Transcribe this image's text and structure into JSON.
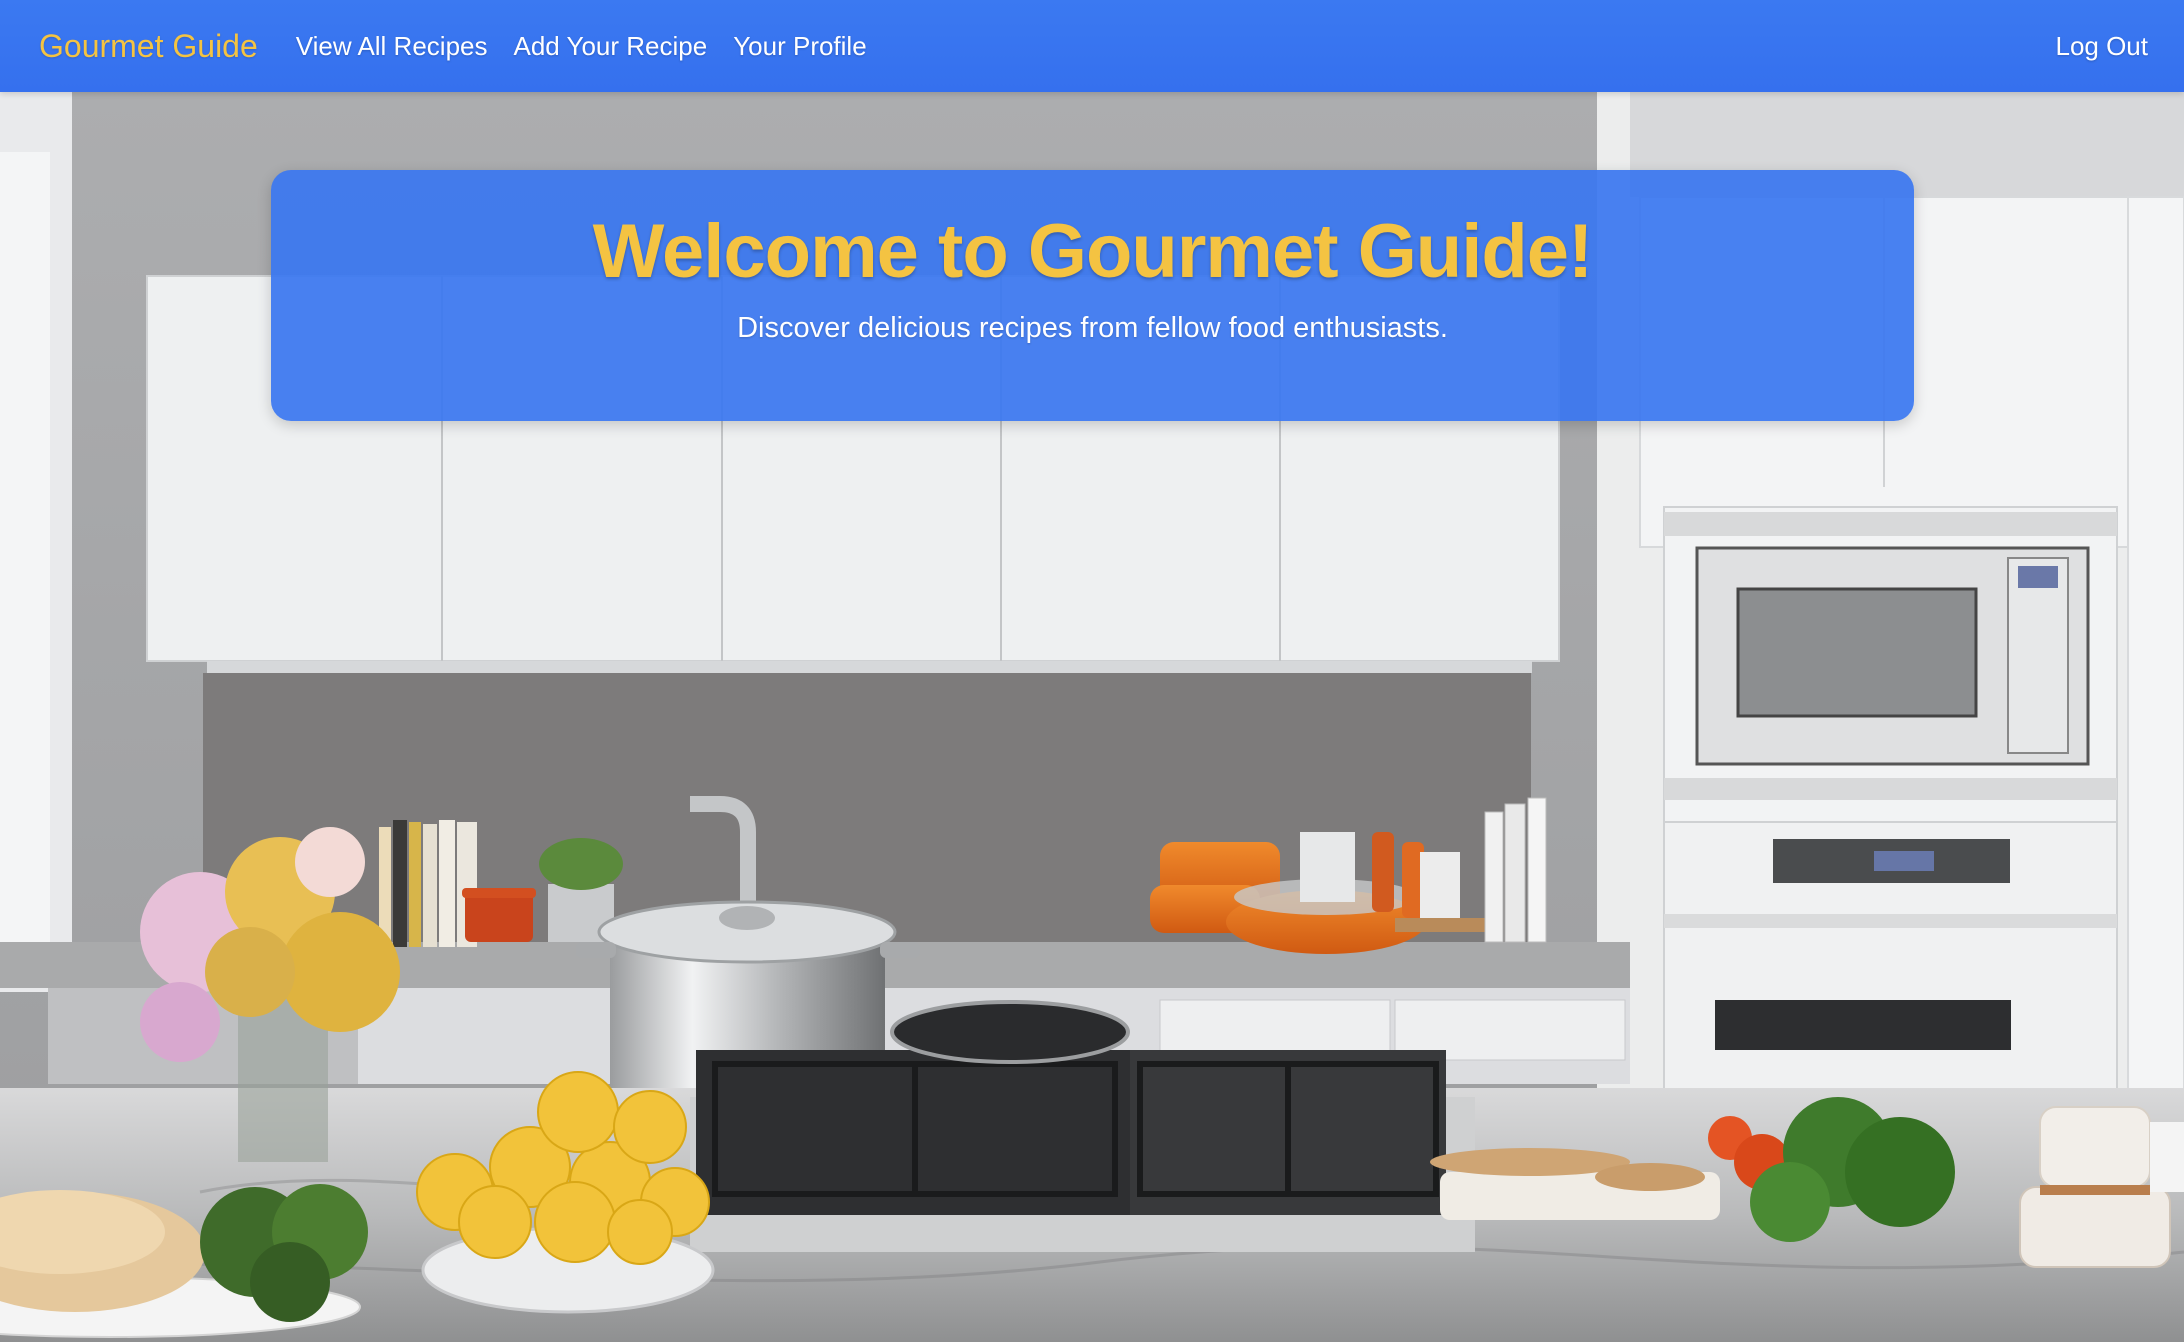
{
  "navbar": {
    "brand": "Gourmet Guide",
    "links": [
      {
        "label": "View All Recipes"
      },
      {
        "label": "Add Your Recipe"
      },
      {
        "label": "Your Profile"
      }
    ],
    "logout": "Log Out"
  },
  "hero": {
    "title": "Welcome to Gourmet Guide!",
    "subtitle": "Discover delicious recipes from fellow food enthusiasts.",
    "background_image": "kitchen-photo"
  },
  "colors": {
    "navbar_bg": "#3b79f1",
    "brand_accent": "#f4c342",
    "text_light": "#ffffff",
    "banner_bg": "#3a76f0"
  }
}
